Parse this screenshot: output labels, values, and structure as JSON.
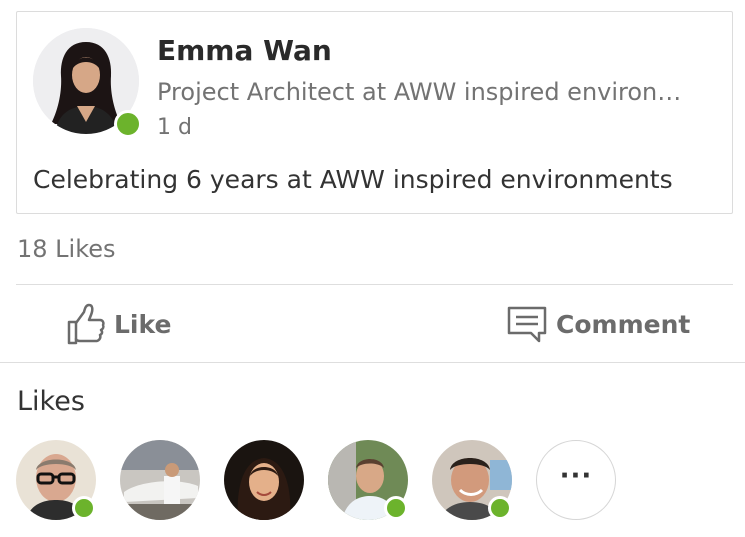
{
  "post": {
    "author_name": "Emma Wan",
    "headline": "Project Architect at AWW inspired environ…",
    "time": "1 d",
    "text": "Celebrating 6 years at AWW inspired environments",
    "presence_color": "#6cb32c"
  },
  "likes_count": "18 Likes",
  "actions": {
    "like_label": "Like",
    "comment_label": "Comment"
  },
  "likes_section": {
    "header": "Likes",
    "more_label": "···",
    "likers": [
      {
        "badge": "online"
      },
      {
        "badge": "none"
      },
      {
        "badge": "none"
      },
      {
        "badge": "mobile"
      },
      {
        "badge": "mobile"
      }
    ]
  },
  "colors": {
    "online_green": "#6cb32c",
    "muted_text": "#737373",
    "divider": "#dedede"
  }
}
